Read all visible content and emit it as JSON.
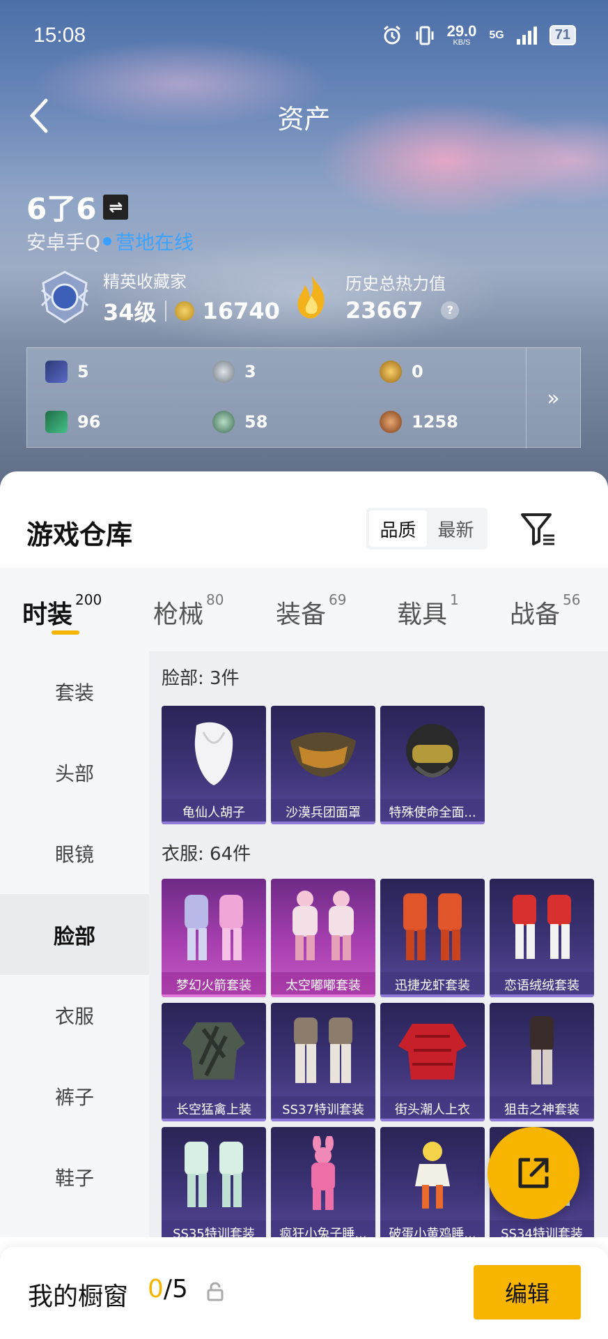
{
  "status_bar": {
    "time": "15:08",
    "net_speed": "29.0",
    "net_unit": "KB/S",
    "signal_label": "5G",
    "battery": "71"
  },
  "header": {
    "title": "资产"
  },
  "profile": {
    "name": "6了6",
    "platform": "安卓手Q",
    "status": "营地在线",
    "collector_label": "精英收藏家",
    "collector_level": "34级",
    "collector_points": "16740",
    "heat_label": "历史总热力值",
    "heat_value": "23667",
    "heat_help": "?"
  },
  "currencies": [
    {
      "icon": "card-ticket-icon",
      "value": "5",
      "color": "#4a5aa8"
    },
    {
      "icon": "silver-coin-icon",
      "value": "3",
      "color": "#9aa3ad"
    },
    {
      "icon": "gold-medal-icon",
      "value": "0",
      "color": "#c98b1c"
    },
    {
      "icon": "green-card-icon",
      "value": "96",
      "color": "#2f9a66"
    },
    {
      "icon": "green-coin-icon",
      "value": "58",
      "color": "#5a9a7a"
    },
    {
      "icon": "bronze-coin-icon",
      "value": "1258",
      "color": "#b0652f"
    }
  ],
  "currency_more_icon": "double-chevron-right-icon",
  "warehouse": {
    "title": "游戏仓库",
    "sort_options": [
      "品质",
      "最新"
    ],
    "sort_active": "品质"
  },
  "tabs": [
    {
      "label": "时装",
      "count": "200",
      "active": true
    },
    {
      "label": "枪械",
      "count": "80"
    },
    {
      "label": "装备",
      "count": "69"
    },
    {
      "label": "载具",
      "count": "1"
    },
    {
      "label": "战备",
      "count": "56"
    }
  ],
  "sidebar": [
    {
      "label": "套装"
    },
    {
      "label": "头部"
    },
    {
      "label": "眼镜"
    },
    {
      "label": "脸部",
      "active": true
    },
    {
      "label": "衣服"
    },
    {
      "label": "裤子"
    },
    {
      "label": "鞋子"
    }
  ],
  "sections": [
    {
      "label": "脸部: 3件",
      "items": [
        {
          "name": "龟仙人胡子",
          "icon": "white-beard-icon"
        },
        {
          "name": "沙漠兵团面罩",
          "icon": "desert-mask-icon"
        },
        {
          "name": "特殊使命全面...",
          "icon": "helmet-mask-icon"
        }
      ]
    },
    {
      "label": "衣服: 64件",
      "items": [
        {
          "name": "梦幻火箭套装",
          "icon": "outfit-icon",
          "rarity": "legendary"
        },
        {
          "name": "太空嘟嘟套装",
          "icon": "outfit-icon",
          "rarity": "legendary"
        },
        {
          "name": "迅捷龙虾套装",
          "icon": "outfit-icon"
        },
        {
          "name": "恋语绒绒套装",
          "icon": "outfit-icon"
        },
        {
          "name": "长空猛禽上装",
          "icon": "jacket-icon"
        },
        {
          "name": "SS37特训套装",
          "icon": "outfit-icon"
        },
        {
          "name": "街头潮人上衣",
          "icon": "jacket-icon"
        },
        {
          "name": "狙击之神套装",
          "icon": "outfit-icon"
        },
        {
          "name": "SS35特训套装",
          "icon": "outfit-icon"
        },
        {
          "name": "疯狂小兔子睡...",
          "icon": "pajama-icon"
        },
        {
          "name": "破蛋小黄鸡睡...",
          "icon": "pajama-icon"
        },
        {
          "name": "SS34特训套装",
          "icon": "outfit-icon"
        }
      ]
    }
  ],
  "share_icon": "share-out-icon",
  "showcase": {
    "label": "我的橱窗",
    "current": "0",
    "total": "/5",
    "edit_label": "编辑"
  }
}
